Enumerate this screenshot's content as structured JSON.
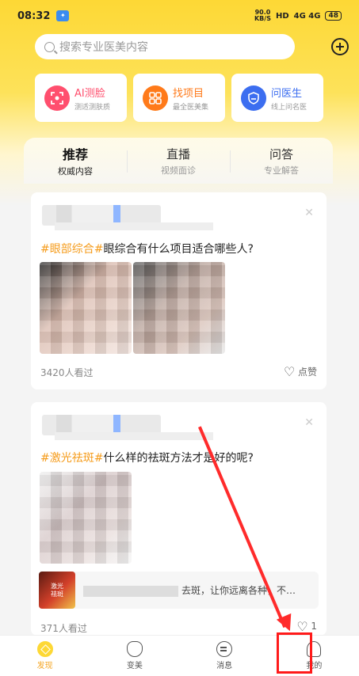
{
  "status_bar": {
    "time": "08:32",
    "speed": "90.0\nKB/S",
    "hd": "HD",
    "signal": "4G 4G",
    "battery": "48"
  },
  "search": {
    "placeholder": "搜索专业医美内容"
  },
  "features": [
    {
      "title": "AI测脸",
      "sub": "测适测肤质",
      "icon": "face-scan-icon"
    },
    {
      "title": "找项目",
      "sub": "最全医美集",
      "icon": "grid-icon"
    },
    {
      "title": "问医生",
      "sub": "线上问名医",
      "icon": "doctor-shield-icon"
    }
  ],
  "tabs": [
    {
      "title": "推荐",
      "sub": "权威内容"
    },
    {
      "title": "直播",
      "sub": "视频面诊"
    },
    {
      "title": "问答",
      "sub": "专业解答"
    }
  ],
  "posts": [
    {
      "hashtag": "#眼部综合#",
      "title": "眼综合有什么项目适合哪些人?",
      "views": "3420人看过",
      "likes": "点赞"
    },
    {
      "hashtag": "#激光祛斑#",
      "title": "什么样的祛斑方法才是好的呢?",
      "product_text": "去斑，让你远离各种，不…",
      "product_thumb": "激光\n祛斑",
      "views": "371人看过",
      "likes": "1"
    }
  ],
  "nav": [
    {
      "label": "发现",
      "icon": "discover-icon"
    },
    {
      "label": "变美",
      "icon": "beauty-icon"
    },
    {
      "label": "消息",
      "icon": "message-icon"
    },
    {
      "label": "我的",
      "icon": "profile-icon"
    }
  ],
  "colors": {
    "accent": "#fdd835",
    "hashtag": "#f59b1a",
    "annotation": "#ff2b2b"
  }
}
